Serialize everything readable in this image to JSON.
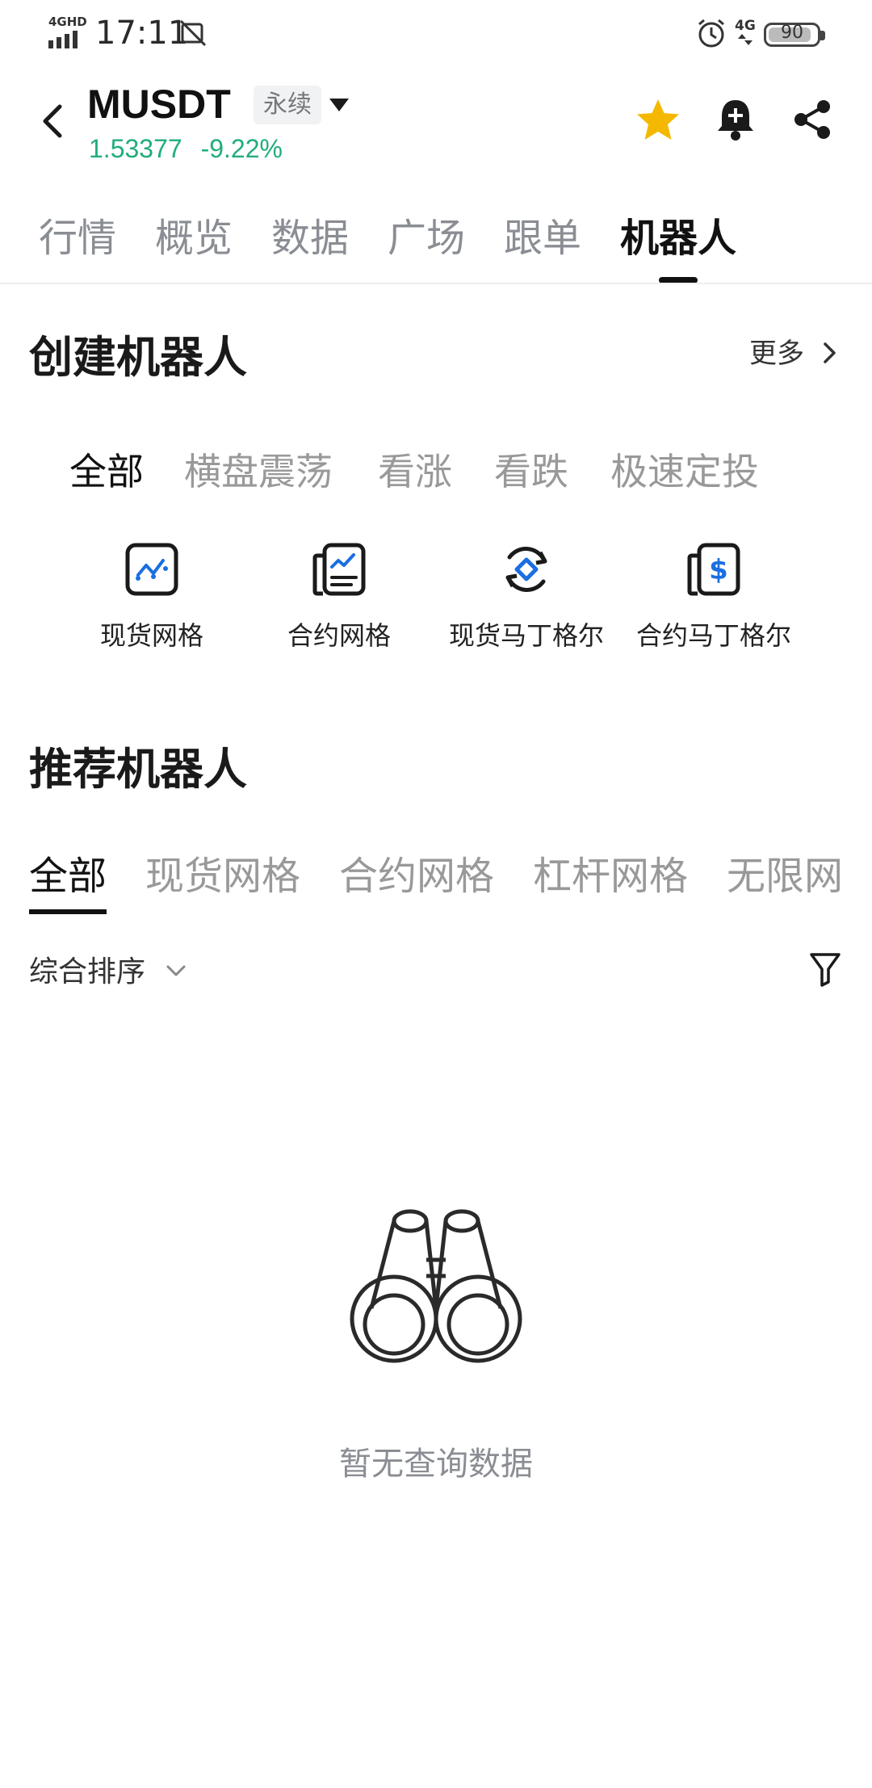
{
  "status_bar": {
    "time": "17:11",
    "network": "4GHD",
    "battery": "90",
    "battery_level": 0.9
  },
  "header": {
    "symbol": "MUSDT",
    "contract_type": "永续",
    "price": "1.53377",
    "change": "-9.22%",
    "price_color": "#1fae7a",
    "star_color": "#f5b800"
  },
  "tabs": [
    "行情",
    "概览",
    "数据",
    "广场",
    "跟单",
    "机器人"
  ],
  "active_tab": "机器人",
  "create_section": {
    "title": "创建机器人",
    "more_label": "更多",
    "categories": [
      "全部",
      "横盘震荡",
      "看涨",
      "看跌",
      "极速定投"
    ],
    "active_category": "全部",
    "bots": [
      {
        "label": "现货网格",
        "icon": "spot-grid-icon"
      },
      {
        "label": "合约网格",
        "icon": "futures-grid-icon"
      },
      {
        "label": "现货马丁格尔",
        "icon": "spot-martingale-icon"
      },
      {
        "label": "合约马丁格尔",
        "icon": "futures-martingale-icon"
      }
    ],
    "accent_color": "#1a6fe0"
  },
  "recommend_section": {
    "title": "推荐机器人",
    "tabs": [
      "全部",
      "现货网格",
      "合约网格",
      "杠杆网格",
      "无限网"
    ],
    "active_tab": "全部",
    "sort_label": "综合排序",
    "empty_text": "暂无查询数据"
  }
}
